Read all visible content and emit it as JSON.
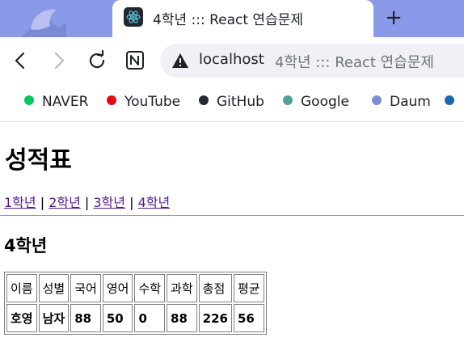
{
  "browser": {
    "tab": {
      "title": "4학년 ::: React 연습문제"
    },
    "new_tab_symbol": "+",
    "address": {
      "host": "localhost",
      "path_title": "4학년 ::: React 연습문제"
    },
    "bookmarks": [
      {
        "label": "NAVER",
        "color": "#03c75a"
      },
      {
        "label": "YouTube",
        "color": "#e50914"
      },
      {
        "label": "GitHub",
        "color": "#24292f"
      },
      {
        "label": "Google",
        "color": "#4fa095"
      },
      {
        "label": "Daum",
        "color": "#7d8fd4"
      },
      {
        "label": "",
        "color": "#1a67b0"
      }
    ]
  },
  "page": {
    "title": "성적표",
    "grade_links": [
      "1학년",
      "2학년",
      "3학년",
      "4학년"
    ],
    "separator": "|",
    "section_title": "4학년",
    "table": {
      "headers": [
        "이름",
        "성별",
        "국어",
        "영어",
        "수학",
        "과학",
        "총점",
        "평균"
      ],
      "rows": [
        [
          "호영",
          "남자",
          "88",
          "50",
          "0",
          "88",
          "226",
          "56"
        ]
      ]
    }
  },
  "icons": {
    "back": "back-arrow-icon",
    "forward": "forward-arrow-icon",
    "reload": "reload-icon",
    "extension": "notion-icon",
    "security": "warning-icon",
    "favicon": "react-logo-icon"
  }
}
